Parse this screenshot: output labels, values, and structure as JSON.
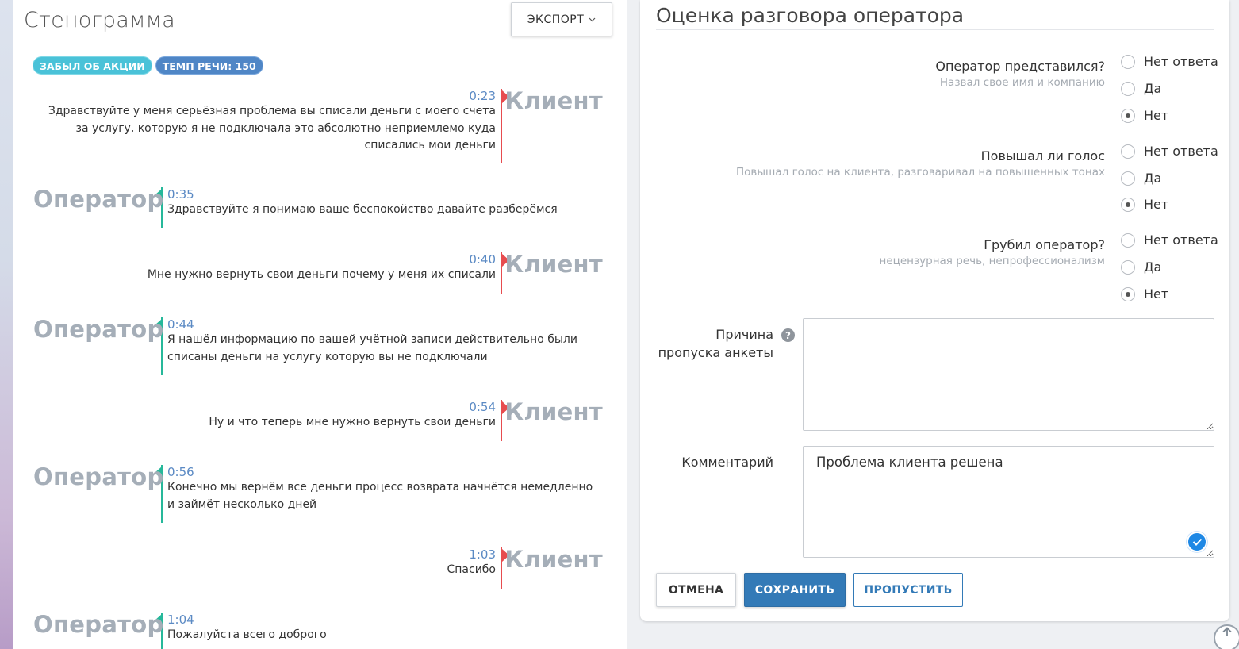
{
  "transcript": {
    "title": "Стенограмма",
    "export_label": "ЭКСПОРТ",
    "tags": [
      "ЗАБЫЛ ОБ АКЦИИ",
      "ТЕМП РЕЧИ: 150"
    ],
    "speakers": {
      "client": "Клиент",
      "operator": "Оператор"
    },
    "messages": [
      {
        "speaker": "client",
        "time": "0:23",
        "text": "Здравствуйте у меня серьёзная проблема вы списали деньги с моего счета за услугу, которую я не подключала это абсолютно неприемлемо куда списались мои деньги"
      },
      {
        "speaker": "operator",
        "time": "0:35",
        "text": "Здравствуйте я понимаю ваше беспокойство давайте разберёмся"
      },
      {
        "speaker": "client",
        "time": "0:40",
        "text": "Мне нужно вернуть свои деньги почему у меня их списали"
      },
      {
        "speaker": "operator",
        "time": "0:44",
        "text": "Я нашёл информацию по вашей учётной записи действительно были списаны деньги на услугу которую вы не подключали"
      },
      {
        "speaker": "client",
        "time": "0:54",
        "text": "Ну и что теперь мне нужно вернуть свои деньги"
      },
      {
        "speaker": "operator",
        "time": "0:56",
        "text": "Конечно мы вернём все деньги процесс возврата начнётся немедленно и займёт несколько дней"
      },
      {
        "speaker": "client",
        "time": "1:03",
        "text": "Спасибо"
      },
      {
        "speaker": "operator",
        "time": "1:04",
        "text": "Пожалуйста всего доброго"
      }
    ]
  },
  "evaluation": {
    "title": "Оценка разговора оператора",
    "options": [
      "Нет ответа",
      "Да",
      "Нет"
    ],
    "questions": [
      {
        "title": "Оператор представился?",
        "subtitle": "Назвал свое имя и компанию",
        "selected": "Нет"
      },
      {
        "title": "Повышал ли голос",
        "subtitle": "Повышал голос на клиента, разговаривал на повышенных тонах",
        "selected": "Нет"
      },
      {
        "title": "Грубил оператор?",
        "subtitle": "нецензурная речь, непрофессионализм",
        "selected": "Нет"
      }
    ],
    "skip_reason": {
      "label_line1": "Причина",
      "label_line2": "пропуска анкеты",
      "value": ""
    },
    "comment": {
      "label": "Комментарий",
      "value": "Проблема клиента решена"
    },
    "buttons": {
      "cancel": "ОТМЕНА",
      "save": "СОХРАНИТЬ",
      "skip": "ПРОПУСТИТЬ"
    }
  },
  "colors": {
    "client_accent": "#e74c4f",
    "operator_accent": "#26b89a",
    "time": "#5b8ac4",
    "primary": "#337ab7",
    "tag_teal": "#4ac2d8",
    "tag_blue": "#4f86c6"
  },
  "icons": [
    "chevron-down-icon",
    "help-icon",
    "checkmark-icon",
    "arrow-up-icon"
  ]
}
